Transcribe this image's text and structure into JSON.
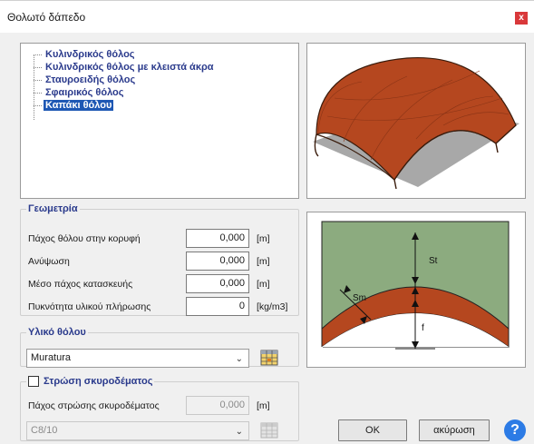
{
  "window": {
    "title": "Θολωτό δάπεδο",
    "close_glyph": "x"
  },
  "tree": {
    "items": [
      {
        "label": "Κυλινδρικός θόλος",
        "selected": false
      },
      {
        "label": "Κυλινδρικός θόλος με κλειστά άκρα",
        "selected": false
      },
      {
        "label": "Σταυροειδής θόλος",
        "selected": false
      },
      {
        "label": "Σφαιρικός θόλος",
        "selected": false
      },
      {
        "label": "Καπάκι θόλου",
        "selected": true
      }
    ]
  },
  "geometry": {
    "legend": "Γεωμετρία",
    "rows": [
      {
        "label": "Πάχος θόλου στην κορυφή",
        "value": "0,000",
        "unit": "[m]"
      },
      {
        "label": "Ανύψωση",
        "value": "0,000",
        "unit": "[m]"
      },
      {
        "label": "Μέσο πάχος κατασκευής",
        "value": "0,000",
        "unit": "[m]"
      },
      {
        "label": "Πυκνότητα υλικού πλήρωσης",
        "value": "0",
        "unit": "[kg/m3]"
      }
    ]
  },
  "material": {
    "legend": "Υλικό θόλου",
    "selected": "Muratura"
  },
  "screed": {
    "legend": "Στρώση σκυροδέματος",
    "checked": false,
    "thickness_label": "Πάχος στρώσης σκυροδέματος",
    "thickness_value": "0,000",
    "thickness_unit": "[m]",
    "concrete_selected": "C8/10"
  },
  "section_labels": {
    "st": "St",
    "sm": "Sm",
    "f": "f"
  },
  "buttons": {
    "ok": "OK",
    "cancel": "ακύρωση",
    "help": "?"
  },
  "colors": {
    "vault_brick": "#b5471f",
    "vault_fill": "#8cab7f",
    "selection": "#1e58b4",
    "legend_blue": "#2a3a8c",
    "help_blue": "#2c7be5",
    "close_red": "#d9383a"
  },
  "icons": {
    "combo_arrow": "chevron-down-icon",
    "grid": "grid-table-icon",
    "help": "help-icon"
  }
}
